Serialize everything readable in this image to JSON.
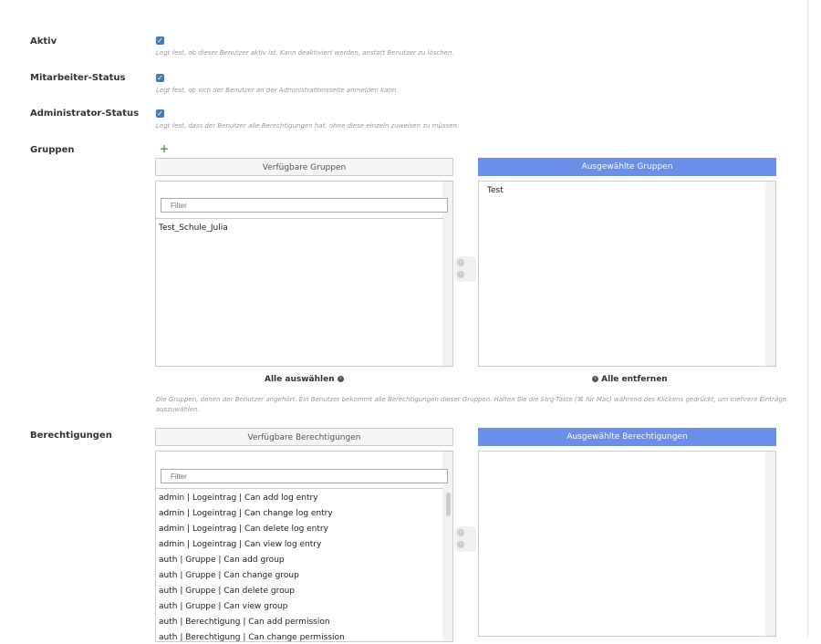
{
  "fields": {
    "active": {
      "label": "Aktiv",
      "checked": true,
      "help": "Legt fest, ob dieser Benutzer aktiv ist. Kann deaktiviert werden, anstatt Benutzer zu löschen."
    },
    "staff": {
      "label": "Mitarbeiter-Status",
      "checked": true,
      "help": "Legt fest, ob sich der Benutzer an der Administrationsseite anmelden kann."
    },
    "superuser": {
      "label": "Administrator-Status",
      "checked": true,
      "help": "Legt fest, dass der Benutzer alle Berechtigungen hat, ohne diese einzeln zuweisen zu müssen."
    }
  },
  "groups": {
    "label": "Gruppen",
    "add_icon": "plus-icon",
    "available_title": "Verfügbare Gruppen",
    "chosen_title": "Ausgewählte Gruppen",
    "filter_placeholder": "Filter",
    "available": [
      "Test_Schule_Julia"
    ],
    "chosen": [
      "Test"
    ],
    "choose_all": "Alle auswählen",
    "remove_all": "Alle entfernen",
    "help": "Die Gruppen, denen der Benutzer angehört. Ein Benutzer bekommt alle Berechtigungen dieser Gruppen. Halten Sie die Strg-Taste (⌘ für Mac) während des Klickens gedrückt, um mehrere Einträge auszuwählen."
  },
  "permissions": {
    "label": "Berechtigungen",
    "available_title": "Verfügbare Berechtigungen",
    "chosen_title": "Ausgewählte Berechtigungen",
    "filter_placeholder": "Filter",
    "available": [
      "admin | Logeintrag | Can add log entry",
      "admin | Logeintrag | Can change log entry",
      "admin | Logeintrag | Can delete log entry",
      "admin | Logeintrag | Can view log entry",
      "auth | Gruppe | Can add group",
      "auth | Gruppe | Can change group",
      "auth | Gruppe | Can delete group",
      "auth | Gruppe | Can view group",
      "auth | Berechtigung | Can add permission",
      "auth | Berechtigung | Can change permission"
    ],
    "chosen": []
  },
  "colors": {
    "checkbox": "#417ab8",
    "chosen_header": "#6b8fe8",
    "add_icon": "#3fab3f"
  }
}
